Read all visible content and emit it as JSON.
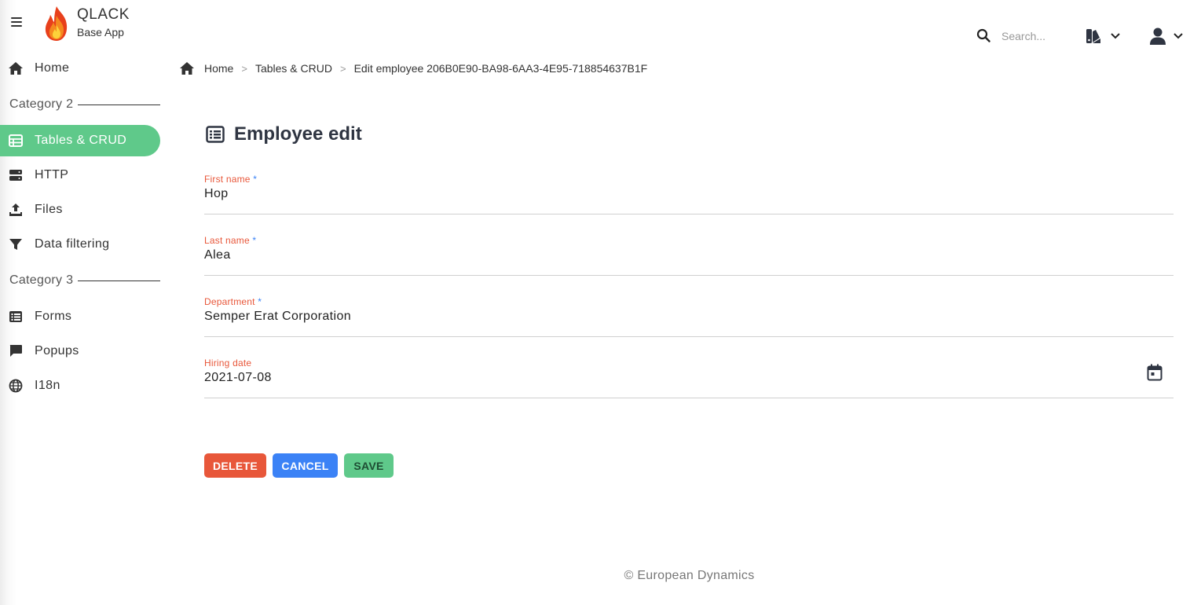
{
  "app": {
    "title": "QLACK",
    "subtitle": "Base App"
  },
  "sidebar": {
    "home": "Home",
    "category2": "Category 2",
    "category3": "Category 3",
    "items": [
      {
        "label": "Tables & CRUD",
        "icon": "table-icon",
        "active": true
      },
      {
        "label": "HTTP",
        "icon": "server-icon"
      },
      {
        "label": "Files",
        "icon": "upload-icon"
      },
      {
        "label": "Data filtering",
        "icon": "filter-icon"
      },
      {
        "label": "Forms",
        "icon": "list-icon"
      },
      {
        "label": "Popups",
        "icon": "comment-icon"
      },
      {
        "label": "I18n",
        "icon": "globe-icon"
      }
    ]
  },
  "search": {
    "placeholder": "Search..."
  },
  "breadcrumb": {
    "home": "Home",
    "section": "Tables & CRUD",
    "current": "Edit employee 206B0E90-BA98-6AA3-4E95-718854637B1F"
  },
  "form": {
    "title": "Employee edit",
    "first_name": {
      "label": "First name",
      "required": "*",
      "value": "Hop"
    },
    "last_name": {
      "label": "Last name",
      "required": "*",
      "value": "Alea"
    },
    "department": {
      "label": "Department",
      "required": "*",
      "value": "Semper Erat Corporation"
    },
    "hiring_date": {
      "label": "Hiring date",
      "value": "2021-07-08"
    }
  },
  "actions": {
    "delete": "DELETE",
    "cancel": "CANCEL",
    "save": "SAVE"
  },
  "footer": {
    "text": "© European Dynamics"
  },
  "colors": {
    "accent": "#5fc98a",
    "danger": "#e8573a",
    "primary": "#3b82f6",
    "label": "#e8573a"
  }
}
